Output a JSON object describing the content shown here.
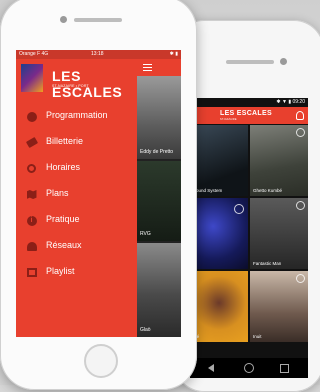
{
  "front": {
    "status": {
      "carrier": "Orange F  4G",
      "time": "13:18",
      "right": "✱ ▮"
    },
    "logo": {
      "title": "LES ESCALES",
      "subtitle": "ST-NAZAIRE • PORT"
    },
    "menu": [
      {
        "label": "Programmation",
        "icon": "disc-icon"
      },
      {
        "label": "Billetterie",
        "icon": "ticket-icon"
      },
      {
        "label": "Horaires",
        "icon": "clock-icon"
      },
      {
        "label": "Plans",
        "icon": "map-icon"
      },
      {
        "label": "Pratique",
        "icon": "info-icon"
      },
      {
        "label": "Réseaux",
        "icon": "people-icon"
      },
      {
        "label": "Playlist",
        "icon": "playlist-icon"
      }
    ],
    "tiles": [
      {
        "label": "Eddy de Pretto"
      },
      {
        "label": "RVG"
      },
      {
        "label": "Glaö"
      }
    ]
  },
  "back": {
    "status": {
      "right": "✱ ▼ ▮ 09:20"
    },
    "logo": {
      "title": "LES ESCALES",
      "subtitle": "ST-NAZAIRE"
    },
    "tiles": [
      {
        "label": "Sound System"
      },
      {
        "label": "Ghetto Kumbé"
      },
      {
        "label": ""
      },
      {
        "label": "Fantastic Man"
      },
      {
        "label": "Ibé"
      },
      {
        "label": "Inuit"
      }
    ]
  },
  "colors": {
    "accent": "#e8402e",
    "accent_dark": "#8b1f17"
  }
}
